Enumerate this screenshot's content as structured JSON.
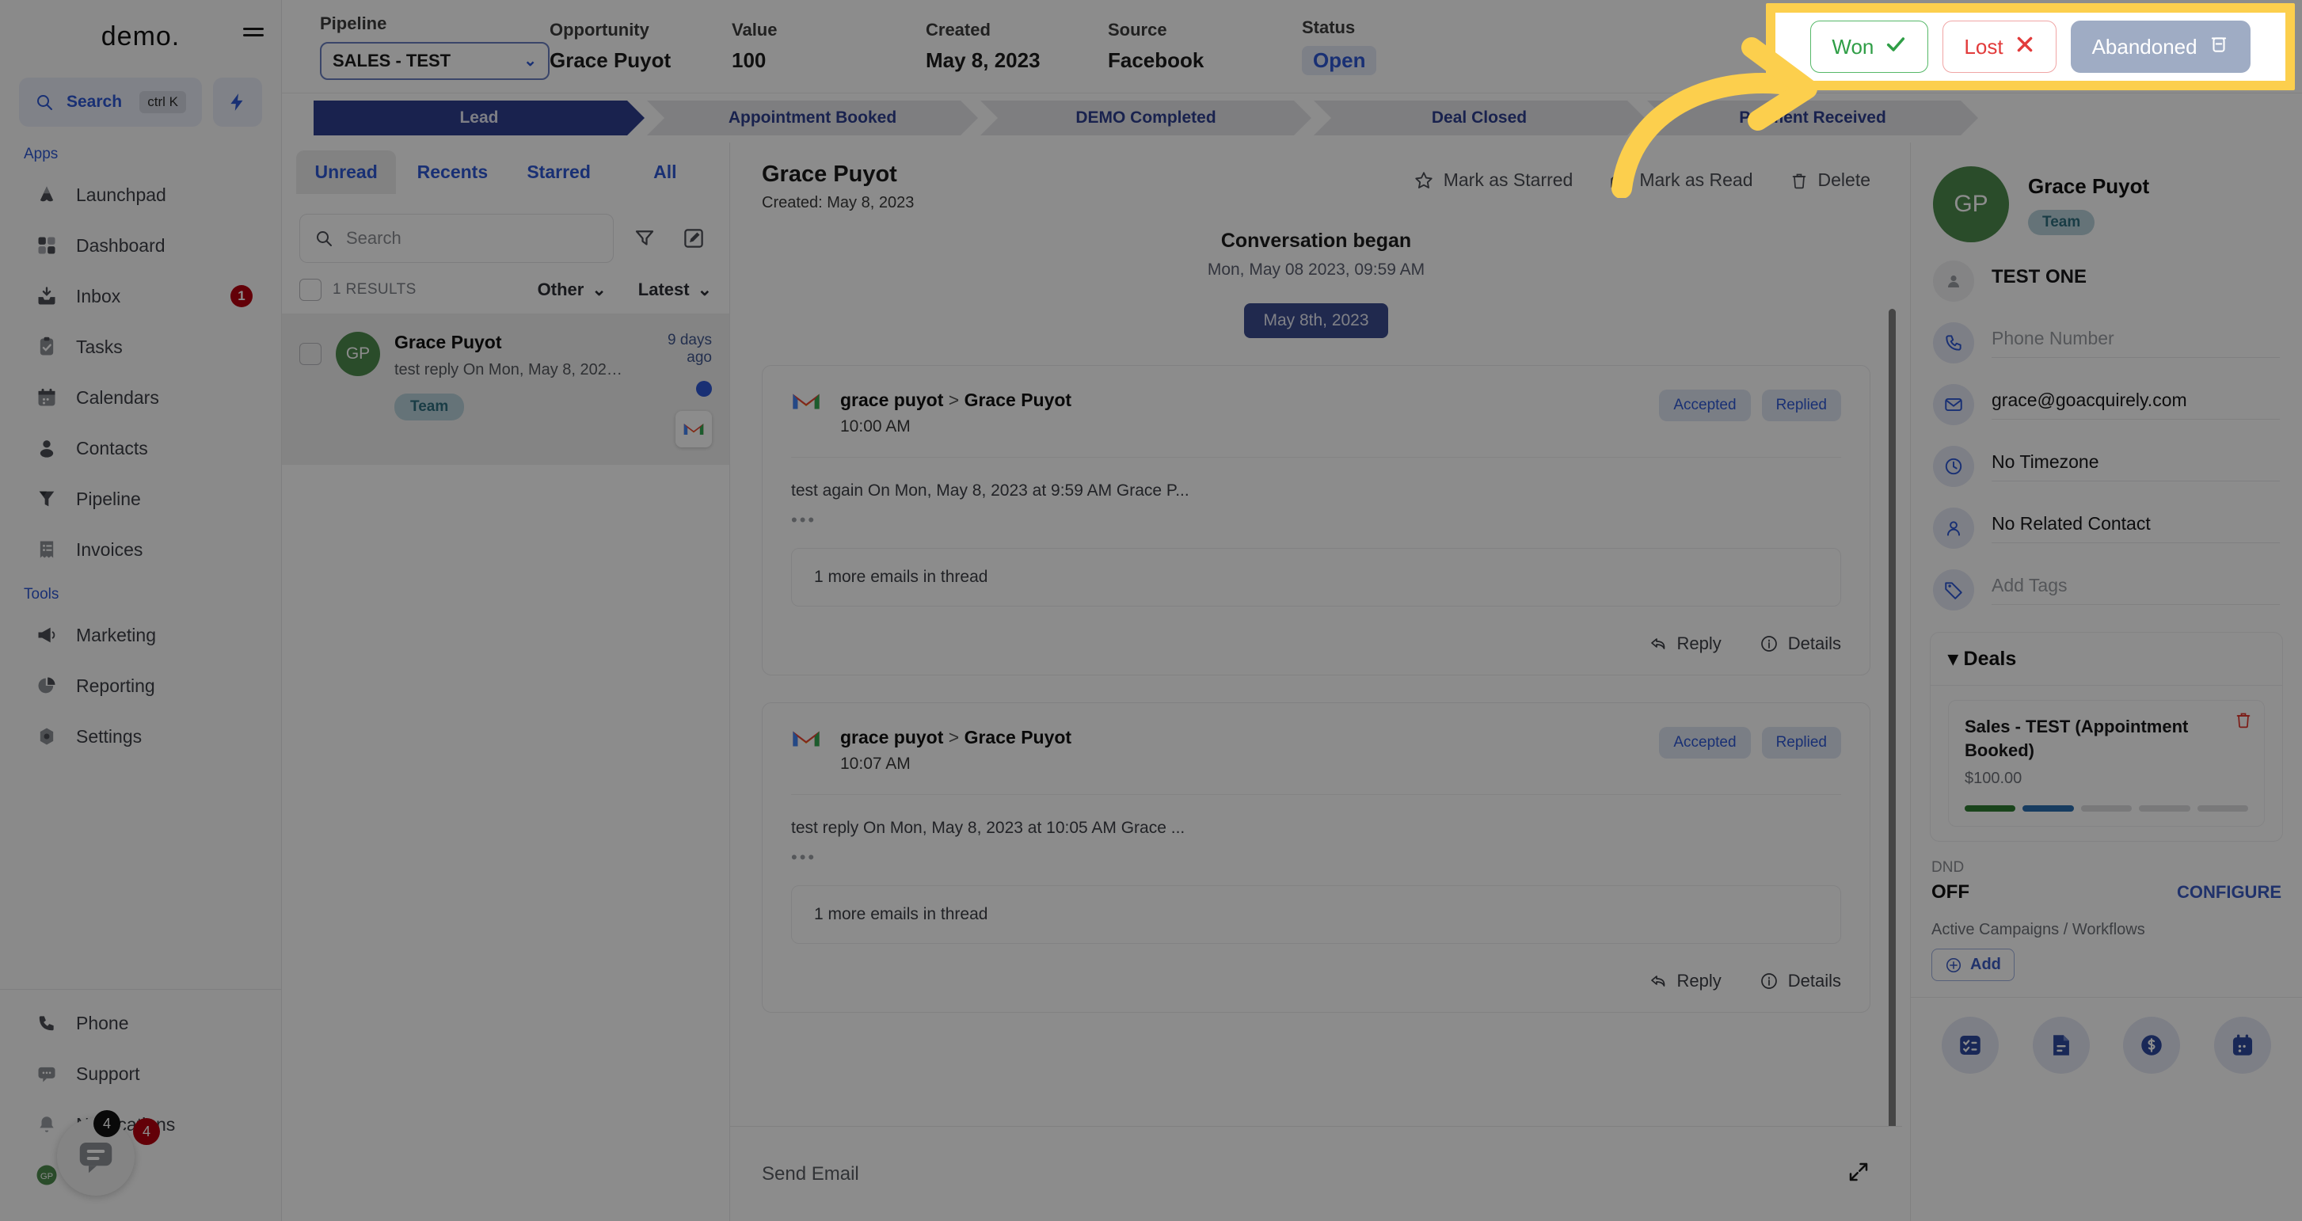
{
  "sidebar": {
    "brand": "demo.",
    "search": {
      "label": "Search",
      "shortcut": "ctrl K"
    },
    "sections": [
      {
        "label": "Apps"
      },
      {
        "label": "Tools"
      }
    ],
    "apps": [
      {
        "label": "Launchpad",
        "icon": "launchpad-icon",
        "badge": ""
      },
      {
        "label": "Dashboard",
        "icon": "dashboard-icon",
        "badge": ""
      },
      {
        "label": "Inbox",
        "icon": "inbox-icon",
        "badge": "1"
      },
      {
        "label": "Tasks",
        "icon": "tasks-icon",
        "badge": ""
      },
      {
        "label": "Calendars",
        "icon": "calendar-icon",
        "badge": ""
      },
      {
        "label": "Contacts",
        "icon": "contacts-icon",
        "badge": ""
      },
      {
        "label": "Pipeline",
        "icon": "pipeline-icon",
        "badge": ""
      },
      {
        "label": "Invoices",
        "icon": "invoices-icon",
        "badge": ""
      }
    ],
    "tools": [
      {
        "label": "Marketing",
        "icon": "megaphone-icon",
        "badge": ""
      },
      {
        "label": "Reporting",
        "icon": "pie-chart-icon",
        "badge": ""
      },
      {
        "label": "Settings",
        "icon": "gear-icon",
        "badge": ""
      }
    ],
    "bottom": [
      {
        "label": "Phone",
        "icon": "phone-icon",
        "badge": ""
      },
      {
        "label": "Support",
        "icon": "chat-icon",
        "badge": ""
      },
      {
        "label": "Notifications",
        "icon": "bell-icon",
        "badge": "4"
      },
      {
        "label": "Profile",
        "icon": "avatar-icon",
        "badge": ""
      }
    ],
    "support_badge_black": "4",
    "support_badge_red": "4"
  },
  "topbar": {
    "fields": [
      {
        "caption": "Pipeline",
        "value": "SALES - TEST"
      },
      {
        "caption": "Opportunity",
        "value": "Grace Puyot"
      },
      {
        "caption": "Value",
        "value": "100"
      },
      {
        "caption": "Created",
        "value": "May 8, 2023"
      },
      {
        "caption": "Source",
        "value": "Facebook"
      },
      {
        "caption": "Status",
        "value": "Open"
      }
    ],
    "user": "TEST ONE",
    "outcomes": [
      {
        "label": "Won",
        "icon": "check-icon"
      },
      {
        "label": "Lost",
        "icon": "x-icon"
      },
      {
        "label": "Abandoned",
        "icon": "trash-icon"
      }
    ]
  },
  "stages": [
    {
      "label": "Lead",
      "active": true
    },
    {
      "label": "Appointment Booked",
      "active": false
    },
    {
      "label": "DEMO Completed",
      "active": false
    },
    {
      "label": "Deal Closed",
      "active": false
    },
    {
      "label": "Payment Received",
      "active": false
    }
  ],
  "conversations": {
    "tabs": [
      {
        "label": "Unread",
        "active": true
      },
      {
        "label": "Recents",
        "active": false
      },
      {
        "label": "Starred",
        "active": false
      },
      {
        "label": "All",
        "active": false
      }
    ],
    "search_placeholder": "Search",
    "results_count": "1 RESULTS",
    "filter_type": "Other",
    "filter_sort": "Latest",
    "items": [
      {
        "initials": "GP",
        "name": "Grace Puyot",
        "preview": "test reply On Mon, May 8, 2023 at ...",
        "time": "9 days ago",
        "tag": "Team",
        "channel": "gmail-icon",
        "unread": true
      }
    ]
  },
  "center": {
    "title": "Grace Puyot",
    "subtitle": "Created: May 8, 2023",
    "actions": [
      {
        "label": "Mark as Starred",
        "icon": "star-icon"
      },
      {
        "label": "Mark as Read",
        "icon": "envelope-open-icon"
      },
      {
        "label": "Delete",
        "icon": "trash-icon"
      }
    ],
    "began_title": "Conversation began",
    "began_date": "Mon, May 08 2023, 09:59 AM",
    "day_pill": "May 8th, 2023",
    "messages": [
      {
        "channel": "gmail-icon",
        "from": "grace puyot",
        "separator": ">",
        "to": "Grace Puyot",
        "time": "10:00 AM",
        "tags": [
          "Accepted",
          "Replied"
        ],
        "body": "test again On Mon, May 8, 2023 at 9:59 AM Grace P...",
        "thread_more": "1 more emails in thread",
        "footer": [
          {
            "label": "Reply",
            "icon": "reply-icon"
          },
          {
            "label": "Details",
            "icon": "info-icon"
          }
        ]
      },
      {
        "channel": "gmail-icon",
        "from": "grace puyot",
        "separator": ">",
        "to": "Grace Puyot",
        "time": "10:07 AM",
        "tags": [
          "Accepted",
          "Replied"
        ],
        "body": "test reply On Mon, May 8, 2023 at 10:05 AM Grace ...",
        "thread_more": "1 more emails in thread",
        "footer": [
          {
            "label": "Reply",
            "icon": "reply-icon"
          },
          {
            "label": "Details",
            "icon": "info-icon"
          }
        ]
      }
    ],
    "composer_placeholder": "Send Email"
  },
  "right": {
    "initials": "GP",
    "name": "Grace Puyot",
    "tag": "Team",
    "owner": "TEST ONE",
    "phone_placeholder": "Phone Number",
    "email": "grace@goacquirely.com",
    "timezone": "No Timezone",
    "related_contact": "No Related Contact",
    "tags_placeholder": "Add Tags",
    "deals": {
      "header": "Deals",
      "items": [
        {
          "title": "Sales - TEST (Appointment Booked)",
          "amount": "$100.00",
          "stage_index": 2,
          "stages": 5
        }
      ]
    },
    "dnd": {
      "label": "DND",
      "value": "OFF",
      "action": "CONFIGURE"
    },
    "campaigns": {
      "label": "Active Campaigns / Workflows",
      "add": "Add"
    },
    "quick_actions": [
      {
        "icon": "task-list-icon"
      },
      {
        "icon": "document-icon"
      },
      {
        "icon": "dollar-icon"
      },
      {
        "icon": "calendar-icon"
      }
    ]
  },
  "colors": {
    "accent_blue": "#2e58d3",
    "stage_active": "#2e3f8f",
    "won_green": "#2f9e46",
    "lost_red": "#e23b3b",
    "abandoned_grey": "#9facc4",
    "highlight_yellow": "#FCCF4D",
    "avatar_green": "#4e8a4e",
    "badge_red": "#b5000f"
  }
}
